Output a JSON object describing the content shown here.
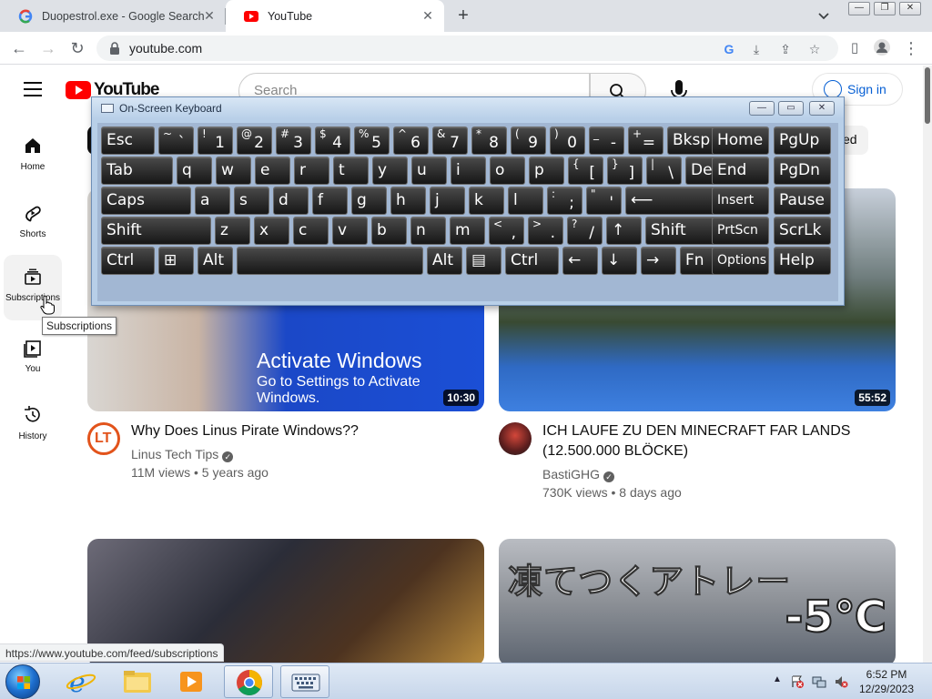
{
  "browser": {
    "tabs": [
      {
        "title": "Duopestrol.exe - Google Search",
        "favicon": "google-icon",
        "active": false
      },
      {
        "title": "YouTube",
        "favicon": "youtube-icon",
        "active": true
      }
    ],
    "new_tab_symbol": "+",
    "url": "youtube.com",
    "status_url": "https://www.youtube.com/feed/subscriptions"
  },
  "youtube": {
    "logo_text": "YouTube",
    "search_placeholder": "Search",
    "sign_in_label": "Sign in",
    "chip_partial_label": "ed",
    "sidebar": [
      {
        "label": "Home",
        "icon": "home-icon"
      },
      {
        "label": "Shorts",
        "icon": "shorts-icon"
      },
      {
        "label": "Subscriptions",
        "icon": "subscriptions-icon"
      },
      {
        "label": "You",
        "icon": "library-icon"
      },
      {
        "label": "History",
        "icon": "history-icon"
      }
    ],
    "tooltip": "Subscriptions",
    "videos": [
      {
        "title": "Why Does Linus Pirate Windows??",
        "channel": "Linus Tech Tips",
        "verified": true,
        "views": "11M views",
        "age": "5 years ago",
        "meta_separator": " • ",
        "duration": "10:30",
        "overlay_title": "Activate Windows",
        "overlay_sub": "Go to Settings to Activate Windows.",
        "avatar_text": "LT"
      },
      {
        "title": "ICH LAUFE ZU DEN MINECRAFT FAR LANDS (12.500.000 BLÖCKE)",
        "channel": "BastiGHG",
        "verified": true,
        "views": "730K views",
        "age": "8 days ago",
        "meta_separator": " • ",
        "duration": "55:52"
      },
      {
        "duration": ""
      },
      {
        "overlay_text": "凍てつくアトレー",
        "overlay_temp": "-5℃"
      }
    ]
  },
  "osk": {
    "title": "On-Screen Keyboard",
    "rows": [
      [
        {
          "main": "Esc"
        },
        {
          "shift": "~",
          "low": "`"
        },
        {
          "shift": "!",
          "low": "1"
        },
        {
          "shift": "@",
          "low": "2"
        },
        {
          "shift": "#",
          "low": "3"
        },
        {
          "shift": "$",
          "low": "4"
        },
        {
          "shift": "%",
          "low": "5"
        },
        {
          "shift": "^",
          "low": "6"
        },
        {
          "shift": "&",
          "low": "7"
        },
        {
          "shift": "*",
          "low": "8"
        },
        {
          "shift": "(",
          "low": "9"
        },
        {
          "shift": ")",
          "low": "0"
        },
        {
          "shift": "_",
          "low": "-"
        },
        {
          "shift": "+",
          "low": "="
        },
        {
          "main": "Bksp"
        },
        {
          "main": "Home"
        },
        {
          "main": "PgUp"
        }
      ],
      [
        {
          "main": "Tab"
        },
        {
          "main": "q"
        },
        {
          "main": "w"
        },
        {
          "main": "e"
        },
        {
          "main": "r"
        },
        {
          "main": "t"
        },
        {
          "main": "y"
        },
        {
          "main": "u"
        },
        {
          "main": "i"
        },
        {
          "main": "o"
        },
        {
          "main": "p"
        },
        {
          "shift": "{",
          "low": "["
        },
        {
          "shift": "}",
          "low": "]"
        },
        {
          "shift": "|",
          "low": "\\"
        },
        {
          "main": "Del"
        },
        {
          "main": "End"
        },
        {
          "main": "PgDn"
        }
      ],
      [
        {
          "main": "Caps"
        },
        {
          "main": "a"
        },
        {
          "main": "s"
        },
        {
          "main": "d"
        },
        {
          "main": "f"
        },
        {
          "main": "g"
        },
        {
          "main": "h"
        },
        {
          "main": "j"
        },
        {
          "main": "k"
        },
        {
          "main": "l"
        },
        {
          "shift": ":",
          "low": ";"
        },
        {
          "shift": "\"",
          "low": "'"
        },
        {
          "main": "⟵"
        },
        {
          "main": "Insert"
        },
        {
          "main": "Pause"
        }
      ],
      [
        {
          "main": "Shift"
        },
        {
          "main": "z"
        },
        {
          "main": "x"
        },
        {
          "main": "c"
        },
        {
          "main": "v"
        },
        {
          "main": "b"
        },
        {
          "main": "n"
        },
        {
          "main": "m"
        },
        {
          "shift": "<",
          "low": ","
        },
        {
          "shift": ">",
          "low": "."
        },
        {
          "shift": "?",
          "low": "/"
        },
        {
          "main": "↑"
        },
        {
          "main": "Shift"
        },
        {
          "main": "PrtScn"
        },
        {
          "main": "ScrLk"
        }
      ],
      [
        {
          "main": "Ctrl"
        },
        {
          "main": "⊞"
        },
        {
          "main": "Alt"
        },
        {
          "main": ""
        },
        {
          "main": "Alt"
        },
        {
          "main": "▤"
        },
        {
          "main": "Ctrl"
        },
        {
          "main": "←"
        },
        {
          "main": "↓"
        },
        {
          "main": "→"
        },
        {
          "main": "Fn"
        },
        {
          "main": "Options"
        },
        {
          "main": "Help"
        }
      ]
    ]
  },
  "taskbar": {
    "time": "6:52 PM",
    "date": "12/29/2023",
    "apps": [
      "internet-explorer-icon",
      "file-explorer-icon",
      "media-player-icon",
      "chrome-icon",
      "on-screen-keyboard-icon"
    ]
  }
}
